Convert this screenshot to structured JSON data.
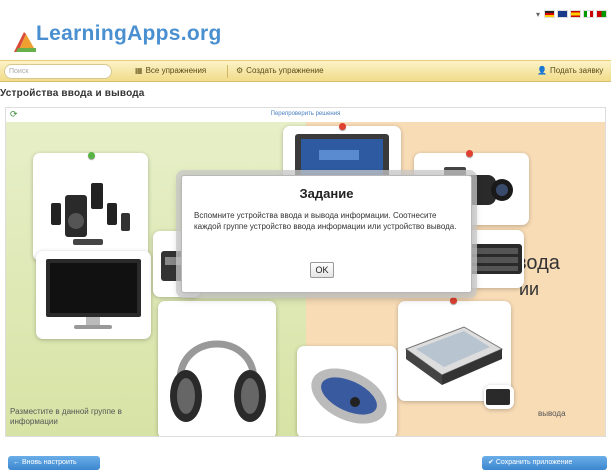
{
  "header": {
    "logo_text": "LearningApps.org",
    "lang_arrow": "▾"
  },
  "nav": {
    "search_placeholder": "Поиск",
    "all_exercises": "Все упражнения",
    "create_exercise": "Создать упражнение",
    "submit_request": "Подать заявку"
  },
  "page": {
    "title": "Устройства ввода и вывода"
  },
  "app": {
    "recheck_link": "Перепроверить решения",
    "left_zone_label": "Разместите в данной группе в информации",
    "right_zone_label": "вывода",
    "right_big_text": "вода",
    "right_big_text2": "ии"
  },
  "modal": {
    "title": "Задание",
    "text": "Вспомните устройства ввода и вывода информации. Соотнесите каждой группе устройство ввода информации или устройство вывода.",
    "ok_label": "OK"
  },
  "footer": {
    "reset_label": "Вновь настроить",
    "save_label": "Сохранить приложение"
  },
  "colors": {
    "navbar": "#f1dc8a",
    "zone_left": "#d7e3a5",
    "zone_right": "#f8dcb6",
    "accent": "#3b86cf",
    "pin_red": "#e04030",
    "pin_green": "#5ab443"
  }
}
